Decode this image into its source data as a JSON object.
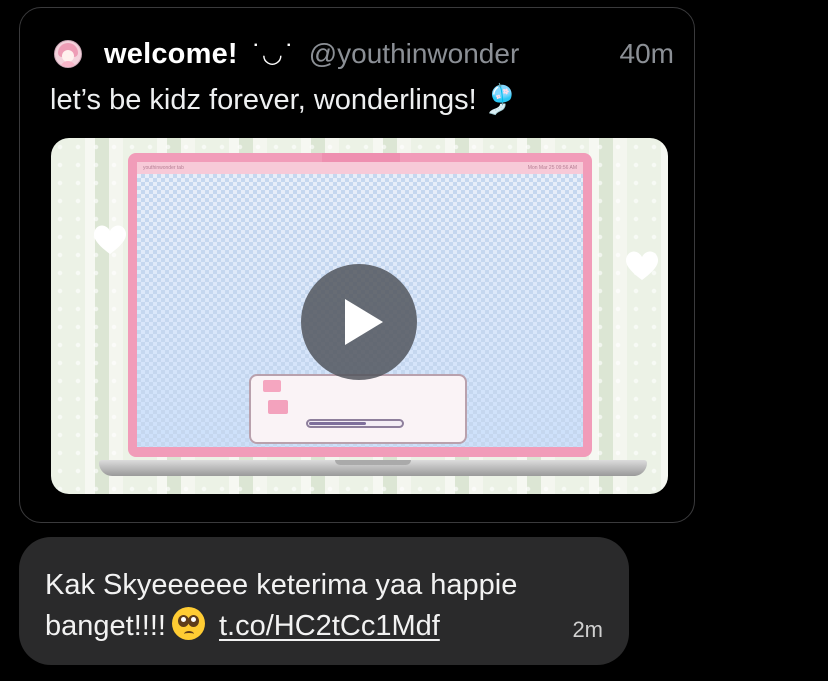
{
  "quoted_tweet": {
    "display_name": "welcome!",
    "kaomoji": "˙◡˙",
    "handle": "@youthinwonder",
    "timestamp": "40m",
    "text": "let’s be kidz forever, wonderlings!",
    "text_glyph": "🎐",
    "media": {
      "type": "video",
      "menubar_left": "youthinwonder tab",
      "menubar_right": "Mon Mar 25 09:56 AM",
      "progress": 0.62
    }
  },
  "message": {
    "line1": "Kak Skyeeeeee keterima yaa happie",
    "line2": "banget!!!!",
    "emoji": "pleading-face",
    "link": "t.co/HC2tCc1Mdf",
    "timestamp": "2m"
  },
  "colors": {
    "background": "#000000",
    "bubble": "#2a2a2b",
    "laptop_pink": "#f19cb9",
    "muted_text": "#8b8f95"
  }
}
